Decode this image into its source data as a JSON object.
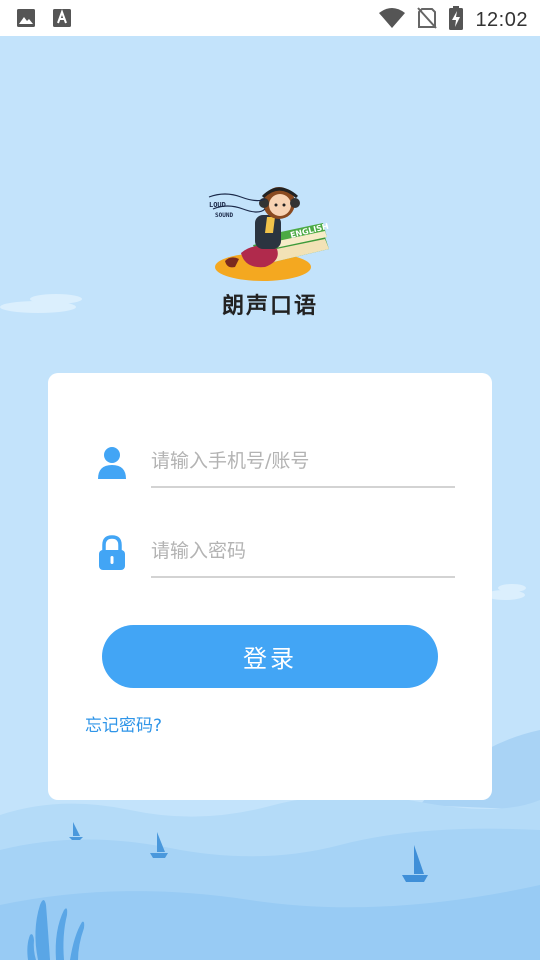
{
  "status_bar": {
    "time": "12:02",
    "icons": [
      "image-icon",
      "text-a-icon",
      "wifi-icon",
      "no-sim-icon",
      "battery-charging-icon"
    ]
  },
  "app": {
    "title": "朗声口语",
    "logo_lettering": [
      "LOUD",
      "SOUND",
      "ENGLISH"
    ]
  },
  "login": {
    "phone_placeholder": "请输入手机号/账号",
    "phone_value": "",
    "password_placeholder": "请输入密码",
    "password_value": "",
    "login_label": "登录",
    "forgot_label": "忘记密码?"
  },
  "colors": {
    "background": "#c3e3fb",
    "accent": "#42a5f5",
    "link": "#2f95e8",
    "card": "#ffffff"
  }
}
